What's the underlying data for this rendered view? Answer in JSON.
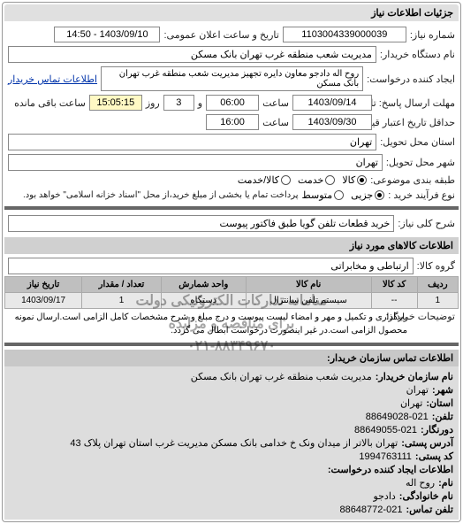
{
  "panel_title": "جزئیات اطلاعات نیاز",
  "fields": {
    "number_label": "شماره نیاز:",
    "number_value": "1103004339000039",
    "announce_label": "تاریخ و ساعت اعلان عمومی:",
    "announce_value": "1403/09/10 - 14:50",
    "buyer_name_label": "نام دستگاه خریدار:",
    "buyer_name_value": "مدیریت شعب منطقه غرب تهران بانک مسکن",
    "request_creator_label": "ایجاد کننده درخواست:",
    "request_creator_value": "روح اله دادجو معاون دایره تجهیز مدیریت شعب منطقه غرب تهران بانک مسکن",
    "buyer_contact_link": "اطلاعات تماس خریدار",
    "deadline_label": "مهلت ارسال پاسخ: تا تاریخ:",
    "deadline_date": "1403/09/14",
    "time_label": "ساعت",
    "deadline_time": "06:00",
    "and_label": "و",
    "days_value": "3",
    "day_label": "روز",
    "remaining_value": "15:05:15",
    "remaining_label": "ساعت باقی مانده",
    "min_validity_label": "حداقل تاریخ اعتبار قیمت: تا تاریخ:",
    "min_validity_date": "1403/09/30",
    "min_validity_time": "16:00",
    "province_label": "استان محل تحویل:",
    "province_value": "تهران",
    "city_label": "شهر محل تحویل:",
    "city_value": "تهران",
    "category_label": "طبقه بندی موضوعی:",
    "category_options": {
      "goods": "کالا",
      "service": "خدمت",
      "both": "کالا/خدمت"
    },
    "purchase_type_label": "نوع فرآیند خرید :",
    "purchase_options": {
      "small": "جزیی",
      "medium": "متوسط"
    },
    "purchase_note": "پرداخت تمام یا بخشی از مبلغ خرید،از محل \"اسناد خزانه اسلامی\" خواهد بود.",
    "desc_label": "شرح کلی نیاز:",
    "desc_value": "خرید قطعات تلفن گویا طبق فاکتور پیوست"
  },
  "items_section": {
    "header": "اطلاعات کالاهای مورد نیاز",
    "group_label": "گروه کالا:",
    "group_value": "ارتباطی و مخابراتی",
    "columns": {
      "row": "ردیف",
      "code": "کد کالا",
      "name": "نام کالا",
      "unit": "واحد شمارش",
      "qty": "تعداد / مقدار",
      "date": "تاریخ نیاز"
    },
    "rows": [
      {
        "row": "1",
        "code": "--",
        "name": "سیستم تلفن سانترال",
        "unit": "دستگاه",
        "qty": "1",
        "date": "1403/09/17"
      }
    ],
    "explain_label": "توضیحات خریدار:",
    "explain_value": "بارگذاری و تکمیل و مهر و امضاء لیست پیوست و درج مبلغ و شرح مشخصات کامل الزامی است.ارسال نمونه محصول الزامی است.در غیر اینصورت درخواست ابطال می گردد."
  },
  "watermark": {
    "line1": "سامانه تدارکات الکترونیکی دولت",
    "line2": "برای مناقصه و مزایده",
    "line3": "۰۲۱-۸۸۳۴۹۶۷۰"
  },
  "contact": {
    "header": "اطلاعات تماس سازمان خریدار:",
    "org_name_label": "نام سازمان خریدار:",
    "org_name_value": "مدیریت شعب منطقه غرب تهران بانک مسکن",
    "city_label": "شهر:",
    "city_value": "تهران",
    "province_label": "استان:",
    "province_value": "تهران",
    "phone_label": "تلفن:",
    "phone_value": "021-88649028",
    "fax_label": "دورنگار:",
    "fax_value": "021-88649055",
    "address_label": "آدرس پستی:",
    "address_value": "تهران بالاتر از میدان ونک خ خدامی بانک مسکن مدیریت غرب استان تهران پلاک 43",
    "postal_label": "کد پستی:",
    "postal_value": "1994763111",
    "creator_header": "اطلاعات ایجاد کننده درخواست:",
    "name_label": "نام:",
    "name_value": "روح اله",
    "family_label": "نام خانوادگی:",
    "family_value": "دادجو",
    "contact_phone_label": "تلفن تماس:",
    "contact_phone_value": "021-88648772"
  }
}
